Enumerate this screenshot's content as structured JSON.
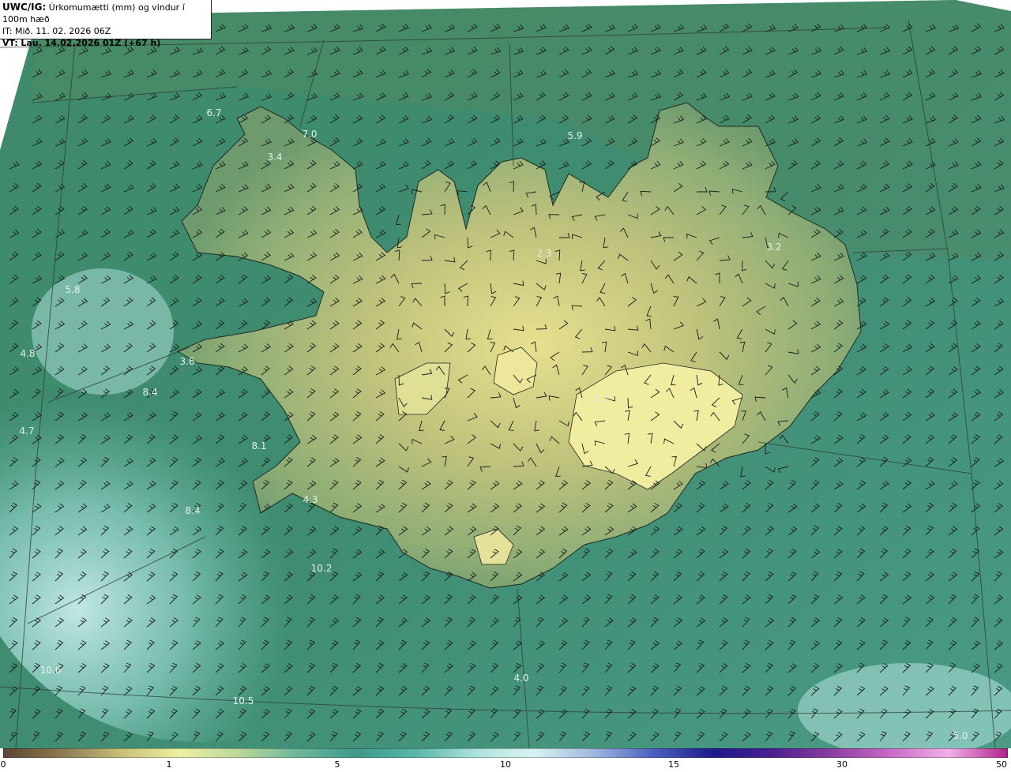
{
  "header": {
    "model": "UWC/IG:",
    "title": "Úrkomumætti (mm) og vindur í 100m hæð",
    "it_line": "IT: Mið. 11. 02. 2026 06Z",
    "vt_label": "VT:",
    "vt_value": "Lau. 14.02.2026 01Z (+67 h)"
  },
  "labels": [
    "6.7",
    "7.0",
    "3.4",
    "5.9",
    "2.3",
    "3.2",
    "4.8",
    "3.6",
    "8.4",
    "4.7",
    "8.1",
    "4.3",
    "8.4",
    "10.2",
    "10.6",
    "10.5",
    "4.0",
    "5.0",
    "5.8",
    "3.1"
  ],
  "colorbar": {
    "ticks": [
      "0",
      "1",
      "5",
      "10",
      "15",
      "30",
      "50"
    ],
    "colors": [
      "#5a4632",
      "#8b7a52",
      "#c9c07a",
      "#eef0a0",
      "#b9d79a",
      "#6db59a",
      "#3c9a8a",
      "#59b8a8",
      "#aee3dd",
      "#d8f2f2",
      "#9fb7e0",
      "#4c5fc0",
      "#1e1a8c",
      "#4a1f8f",
      "#8a3ca0",
      "#c86ac4",
      "#f0b0e8",
      "#b0208a"
    ]
  }
}
